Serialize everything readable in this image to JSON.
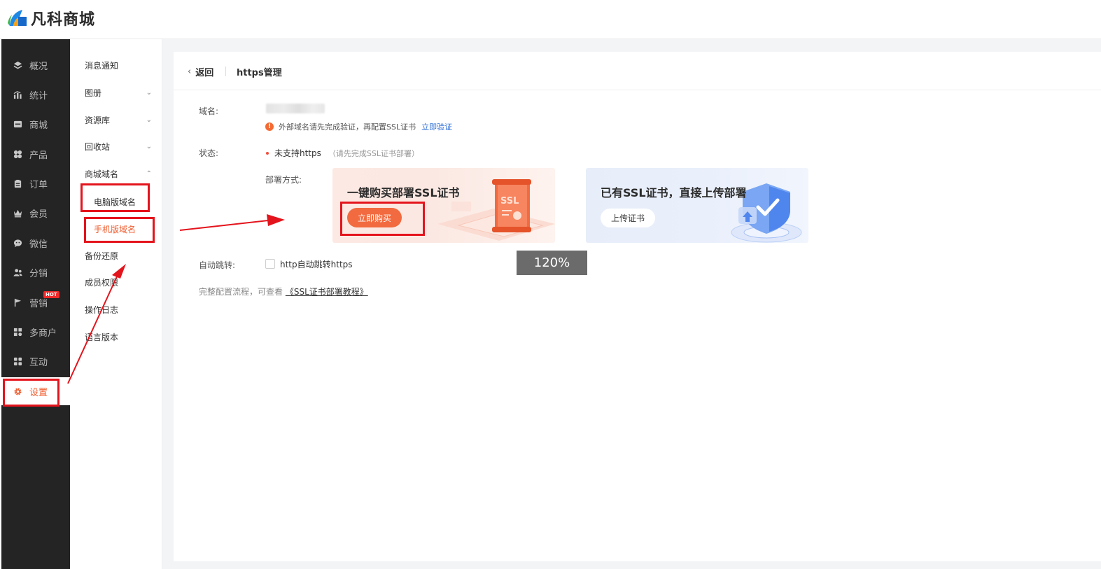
{
  "brand": {
    "name": "凡科商城"
  },
  "sidebar": {
    "items": [
      {
        "label": "概况",
        "icon": "layers-icon"
      },
      {
        "label": "统计",
        "icon": "chart-icon"
      },
      {
        "label": "商城",
        "icon": "store-icon"
      },
      {
        "label": "产品",
        "icon": "grid-icon"
      },
      {
        "label": "订单",
        "icon": "clipboard-icon"
      },
      {
        "label": "会员",
        "icon": "crown-icon"
      },
      {
        "label": "微信",
        "icon": "wechat-icon"
      },
      {
        "label": "分销",
        "icon": "users-icon"
      },
      {
        "label": "营销",
        "icon": "flag-icon",
        "badge": "HOT"
      },
      {
        "label": "多商户",
        "icon": "shop-icon"
      },
      {
        "label": "互动",
        "icon": "apps-icon"
      },
      {
        "label": "设置",
        "icon": "gear-icon",
        "active": true
      }
    ]
  },
  "submenu": {
    "items": [
      {
        "label": "消息通知"
      },
      {
        "label": "图册"
      },
      {
        "label": "资源库"
      },
      {
        "label": "回收站"
      },
      {
        "label": "商城域名"
      },
      {
        "label": "备份还原"
      },
      {
        "label": "成员权限"
      },
      {
        "label": "操作日志"
      },
      {
        "label": "语言版本"
      }
    ],
    "children": [
      {
        "label": "电脑版域名"
      },
      {
        "label": "手机版域名",
        "active": true
      }
    ]
  },
  "header": {
    "back": "返回",
    "title": "https管理"
  },
  "form": {
    "domain_label": "域名:",
    "domain_warning": "外部域名请先完成验证，再配置SSL证书",
    "verify_link": "立即验证",
    "status_label": "状态:",
    "status_value": "未支持https",
    "status_hint": "（请先完成SSL证书部署）",
    "deploy_label": "部署方式:",
    "auto_label": "自动跳转:",
    "auto_option": "http自动跳转https",
    "flow_text": "完整配置流程，可查看",
    "flow_link": "《SSL证书部署教程》"
  },
  "deploy_cards": {
    "buy": {
      "title": "一键购买部署SSL证书",
      "button": "立即购买",
      "badge_text": "SSL"
    },
    "upload": {
      "title": "已有SSL证书，直接上传部署",
      "button": "上传证书"
    }
  },
  "zoom": "120%",
  "colors": {
    "accent": "#f05d2f",
    "link": "#2f6fd6",
    "annotation": "#e4141c",
    "sidebar": "#242424"
  }
}
